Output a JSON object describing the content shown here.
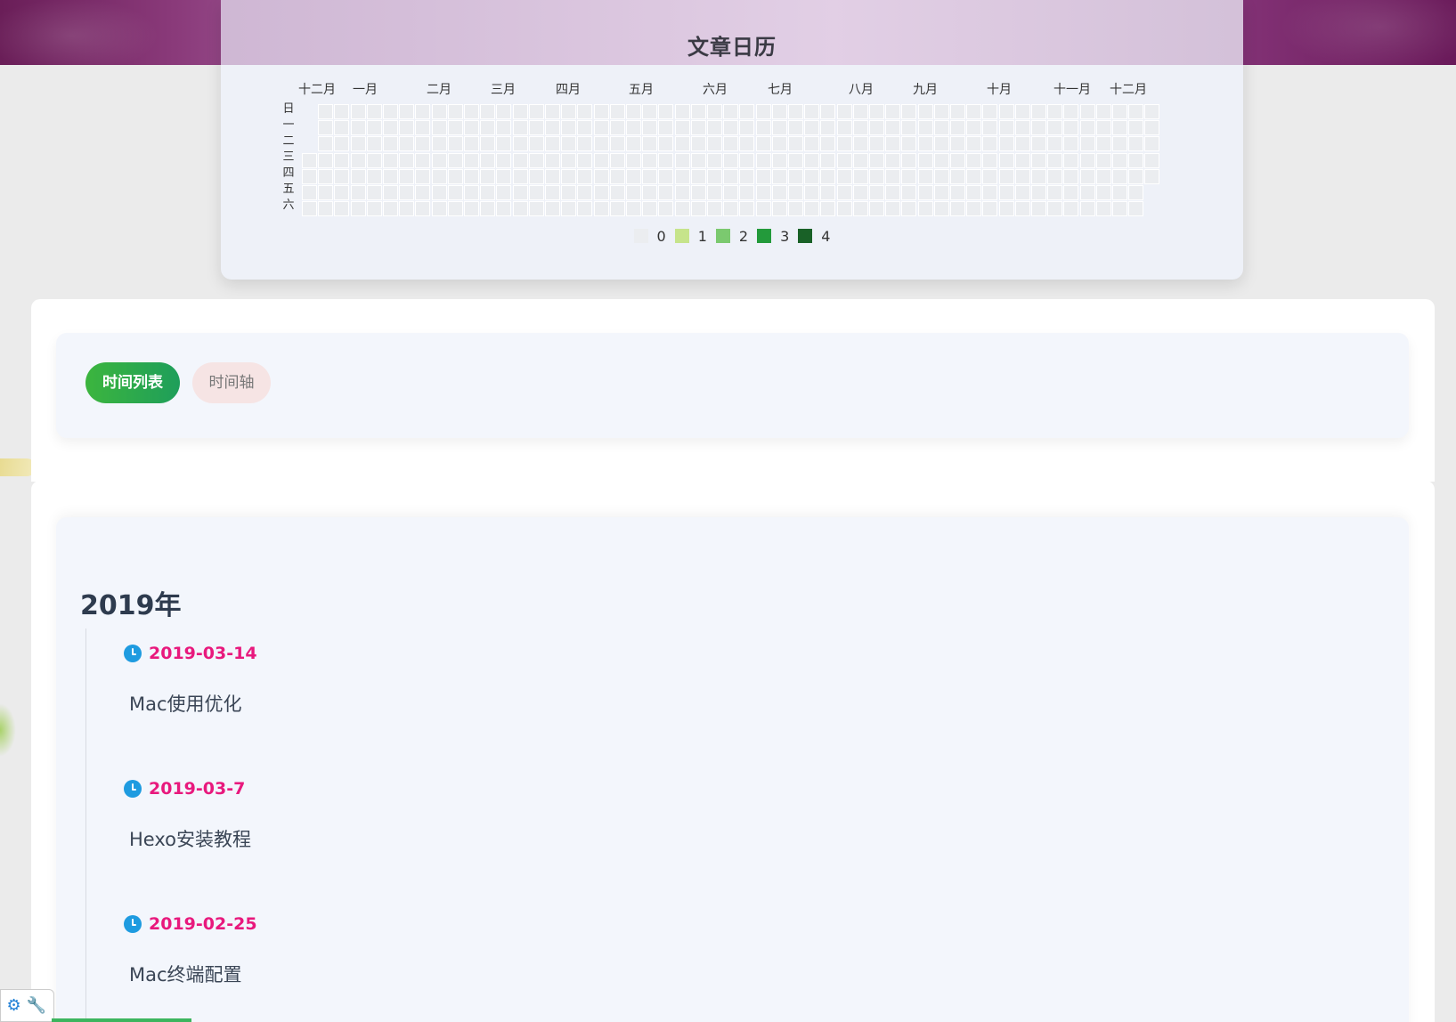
{
  "calendar": {
    "title": "文章日历",
    "months": [
      "十二月",
      "一月",
      "二月",
      "三月",
      "四月",
      "五月",
      "六月",
      "七月",
      "八月",
      "九月",
      "十月",
      "十一月",
      "十二月"
    ],
    "weekdays": [
      "日",
      "一",
      "二",
      "三",
      "四",
      "五",
      "六"
    ],
    "weeks": 53,
    "legend": [
      {
        "label": "0",
        "color": "#ebedf0"
      },
      {
        "label": "1",
        "color": "#c6e48b"
      },
      {
        "label": "2",
        "color": "#7bc96f"
      },
      {
        "label": "3",
        "color": "#239a3b"
      },
      {
        "label": "4",
        "color": "#196127"
      }
    ]
  },
  "tabs": {
    "list_label": "时间列表",
    "axis_label": "时间轴"
  },
  "archive": {
    "year": "2019年",
    "posts": [
      {
        "date": "2019-03-14",
        "title": "Mac使用优化"
      },
      {
        "date": "2019-03-7",
        "title": "Hexo安装教程"
      },
      {
        "date": "2019-02-25",
        "title": "Mac终端配置"
      }
    ]
  },
  "colors": {
    "accent_green": "#3cb53e",
    "date_pink": "#e8197d",
    "clock_blue": "#1e9be0"
  }
}
